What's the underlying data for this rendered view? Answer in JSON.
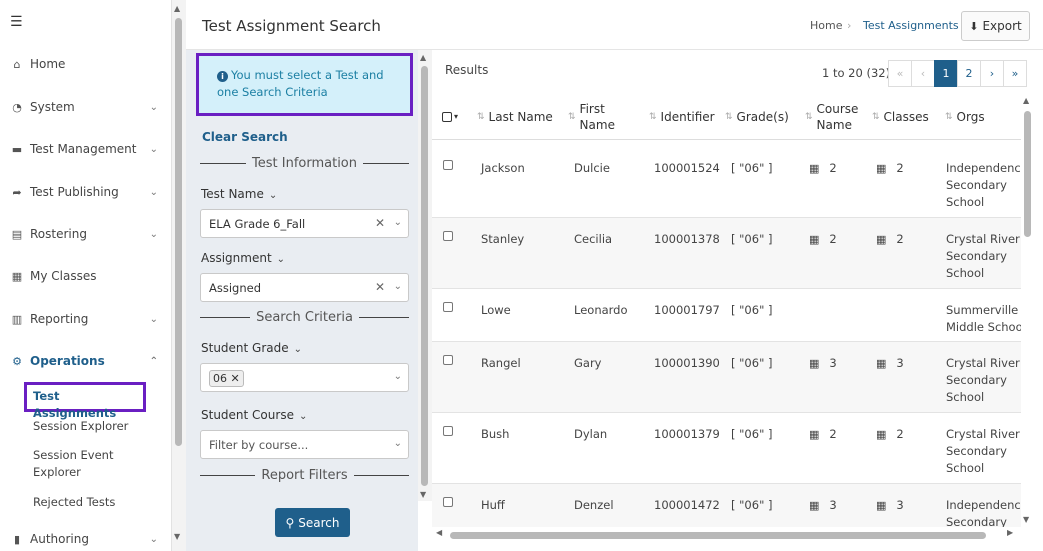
{
  "sidebar": {
    "items": [
      {
        "label": "Home",
        "icon": "home-icon"
      },
      {
        "label": "System",
        "icon": "gauge-icon"
      },
      {
        "label": "Test Management",
        "icon": "folder-icon"
      },
      {
        "label": "Test Publishing",
        "icon": "publish-icon"
      },
      {
        "label": "Rostering",
        "icon": "clipboard-icon"
      },
      {
        "label": "My Classes",
        "icon": "classroom-icon"
      },
      {
        "label": "Reporting",
        "icon": "chart-icon"
      },
      {
        "label": "Operations",
        "icon": "gears-icon"
      },
      {
        "label": "Authoring",
        "icon": "book-icon"
      }
    ],
    "operations_sub": [
      "Test Assignments",
      "Session Explorer",
      "Session Event Explorer",
      "Rejected Tests"
    ]
  },
  "header": {
    "title": "Test Assignment Search",
    "breadcrumb": [
      "Home",
      "Test Assignments"
    ],
    "export_label": "Export"
  },
  "search": {
    "notice": "You must select a Test and one Search Criteria",
    "clear_label": "Clear Search",
    "section_test": "Test Information",
    "test_name_label": "Test Name",
    "test_name_value": "ELA Grade 6_Fall",
    "assignment_label": "Assignment",
    "assignment_value": "Assigned",
    "section_criteria": "Search Criteria",
    "grade_label": "Student Grade",
    "grade_tag": "06",
    "course_label": "Student Course",
    "course_placeholder": "Filter by course...",
    "section_report": "Report Filters",
    "search_label": "Search"
  },
  "results": {
    "title": "Results",
    "range": "1 to 20 (32)",
    "pages": [
      "«",
      "‹",
      "1",
      "2",
      "›",
      "»"
    ],
    "current_page": "1",
    "columns": [
      "Last Name",
      "First Name",
      "Identifier",
      "Grade(s)",
      "Course Name",
      "Classes",
      "Orgs"
    ],
    "rows": [
      {
        "last": "Jackson",
        "first": "Dulcie",
        "id": "100001524",
        "grades": "[ \"06\" ]",
        "course": "2",
        "classes": "2",
        "org": "Independence Secondary School"
      },
      {
        "last": "Stanley",
        "first": "Cecilia",
        "id": "100001378",
        "grades": "[ \"06\" ]",
        "course": "2",
        "classes": "2",
        "org": "Crystal River Secondary School"
      },
      {
        "last": "Lowe",
        "first": "Leonardo",
        "id": "100001797",
        "grades": "[ \"06\" ]",
        "course": "",
        "classes": "",
        "org": "Summerville Middle School"
      },
      {
        "last": "Rangel",
        "first": "Gary",
        "id": "100001390",
        "grades": "[ \"06\" ]",
        "course": "3",
        "classes": "3",
        "org": "Crystal River Secondary School"
      },
      {
        "last": "Bush",
        "first": "Dylan",
        "id": "100001379",
        "grades": "[ \"06\" ]",
        "course": "2",
        "classes": "2",
        "org": "Crystal River Secondary School"
      },
      {
        "last": "Huff",
        "first": "Denzel",
        "id": "100001472",
        "grades": "[ \"06\" ]",
        "course": "3",
        "classes": "3",
        "org": "Independence Secondary School"
      }
    ]
  },
  "colors": {
    "accent": "#1f5f8b",
    "highlight": "#6a1fc2",
    "notice_bg": "#d4f0fa"
  }
}
